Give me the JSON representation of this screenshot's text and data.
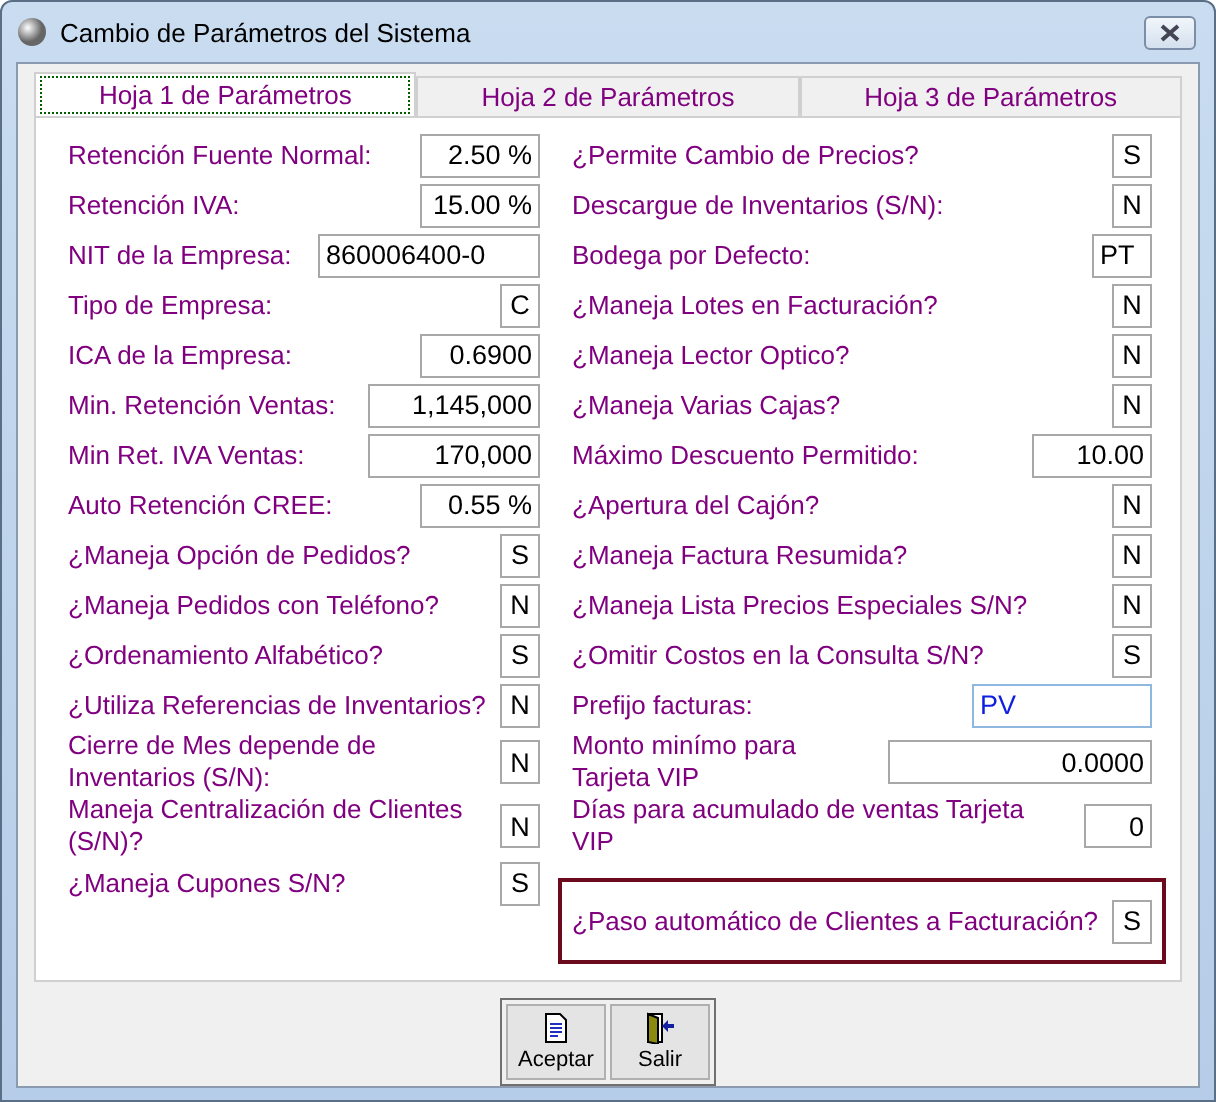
{
  "window": {
    "title": "Cambio de Parámetros del Sistema"
  },
  "tabs": [
    {
      "label": "Hoja 1 de Parámetros",
      "selected": true
    },
    {
      "label": "Hoja 2 de Parámetros",
      "selected": false
    },
    {
      "label": "Hoja 3 de Parámetros",
      "selected": false
    }
  ],
  "left_fields": [
    {
      "label": "Retención Fuente Normal:",
      "value": "2.50 %",
      "kind": "number",
      "focused": false,
      "highlighted": false
    },
    {
      "label": "Retención IVA:",
      "value": "15.00 %",
      "kind": "number",
      "focused": false,
      "highlighted": false
    },
    {
      "label": "NIT de la Empresa:",
      "value": "860006400-0",
      "kind": "wide",
      "focused": false,
      "highlighted": false
    },
    {
      "label": "Tipo de Empresa:",
      "value": "C",
      "kind": "flag",
      "focused": false,
      "highlighted": false
    },
    {
      "label": "ICA de la Empresa:",
      "value": "0.6900",
      "kind": "number",
      "focused": false,
      "highlighted": false
    },
    {
      "label": "Min. Retención Ventas:",
      "value": "1,145,000",
      "kind": "long",
      "focused": false,
      "highlighted": false
    },
    {
      "label": "Min Ret. IVA Ventas:",
      "value": "170,000",
      "kind": "long",
      "focused": false,
      "highlighted": false
    },
    {
      "label": "Auto Retención CREE:",
      "value": "0.55 %",
      "kind": "number",
      "focused": false,
      "highlighted": false
    },
    {
      "label": "¿Maneja Opción de Pedidos?",
      "value": "S",
      "kind": "flag",
      "focused": false,
      "highlighted": false
    },
    {
      "label": "¿Maneja Pedidos con Teléfono?",
      "value": "N",
      "kind": "flag",
      "focused": false,
      "highlighted": false
    },
    {
      "label": "¿Ordenamiento Alfabético?",
      "value": "S",
      "kind": "flag",
      "focused": false,
      "highlighted": false
    },
    {
      "label": "¿Utiliza Referencias de Inventarios?",
      "value": "N",
      "kind": "flag",
      "focused": false,
      "highlighted": false
    },
    {
      "label": "Cierre de Mes depende de Inventarios (S/N):",
      "value": "N",
      "kind": "flag",
      "focused": false,
      "highlighted": false
    },
    {
      "label": "Maneja Centralización de Clientes (S/N)?",
      "value": "N",
      "kind": "flag",
      "focused": false,
      "highlighted": false
    },
    {
      "label": "¿Maneja Cupones S/N?",
      "value": "S",
      "kind": "flag",
      "focused": false,
      "highlighted": false
    }
  ],
  "right_fields": [
    {
      "label": "¿Permite Cambio de Precios?",
      "value": "S",
      "kind": "flag",
      "focused": false,
      "highlighted": false
    },
    {
      "label": "Descargue de Inventarios (S/N):",
      "value": "N",
      "kind": "flag",
      "focused": false,
      "highlighted": false
    },
    {
      "label": "Bodega por Defecto:",
      "value": "PT",
      "kind": "code",
      "focused": false,
      "highlighted": false
    },
    {
      "label": "¿Maneja Lotes en Facturación?",
      "value": "N",
      "kind": "flag",
      "focused": false,
      "highlighted": false
    },
    {
      "label": "¿Maneja Lector Optico?",
      "value": "N",
      "kind": "flag",
      "focused": false,
      "highlighted": false
    },
    {
      "label": "¿Maneja Varias Cajas?",
      "value": "N",
      "kind": "flag",
      "focused": false,
      "highlighted": false
    },
    {
      "label": "Máximo Descuento Permitido:",
      "value": "10.00",
      "kind": "number",
      "focused": false,
      "highlighted": false
    },
    {
      "label": "¿Apertura del Cajón?",
      "value": "N",
      "kind": "flag",
      "focused": false,
      "highlighted": false
    },
    {
      "label": "¿Maneja Factura Resumida?",
      "value": "N",
      "kind": "flag",
      "focused": false,
      "highlighted": false
    },
    {
      "label": "¿Maneja Lista Precios Especiales S/N?",
      "value": "N",
      "kind": "flag",
      "focused": false,
      "highlighted": false
    },
    {
      "label": "¿Omitir Costos en la Consulta S/N?",
      "value": "S",
      "kind": "flag",
      "focused": false,
      "highlighted": false
    },
    {
      "label": "Prefijo facturas:",
      "value": "PV",
      "kind": "prefix",
      "focused": true,
      "highlighted": false
    },
    {
      "label": "Monto minímo para Tarjeta VIP",
      "value": "0.0000",
      "kind": "amount",
      "focused": false,
      "highlighted": false
    },
    {
      "label": "Días para acumulado de ventas Tarjeta VIP",
      "value": "0",
      "kind": "count",
      "focused": false,
      "highlighted": false
    },
    {
      "label": "¿Paso automático de Clientes a Facturación?",
      "value": "S",
      "kind": "flag",
      "focused": false,
      "highlighted": true
    }
  ],
  "buttons": [
    {
      "label": "Aceptar",
      "kind": "document"
    },
    {
      "label": "Salir",
      "kind": "exit"
    }
  ]
}
